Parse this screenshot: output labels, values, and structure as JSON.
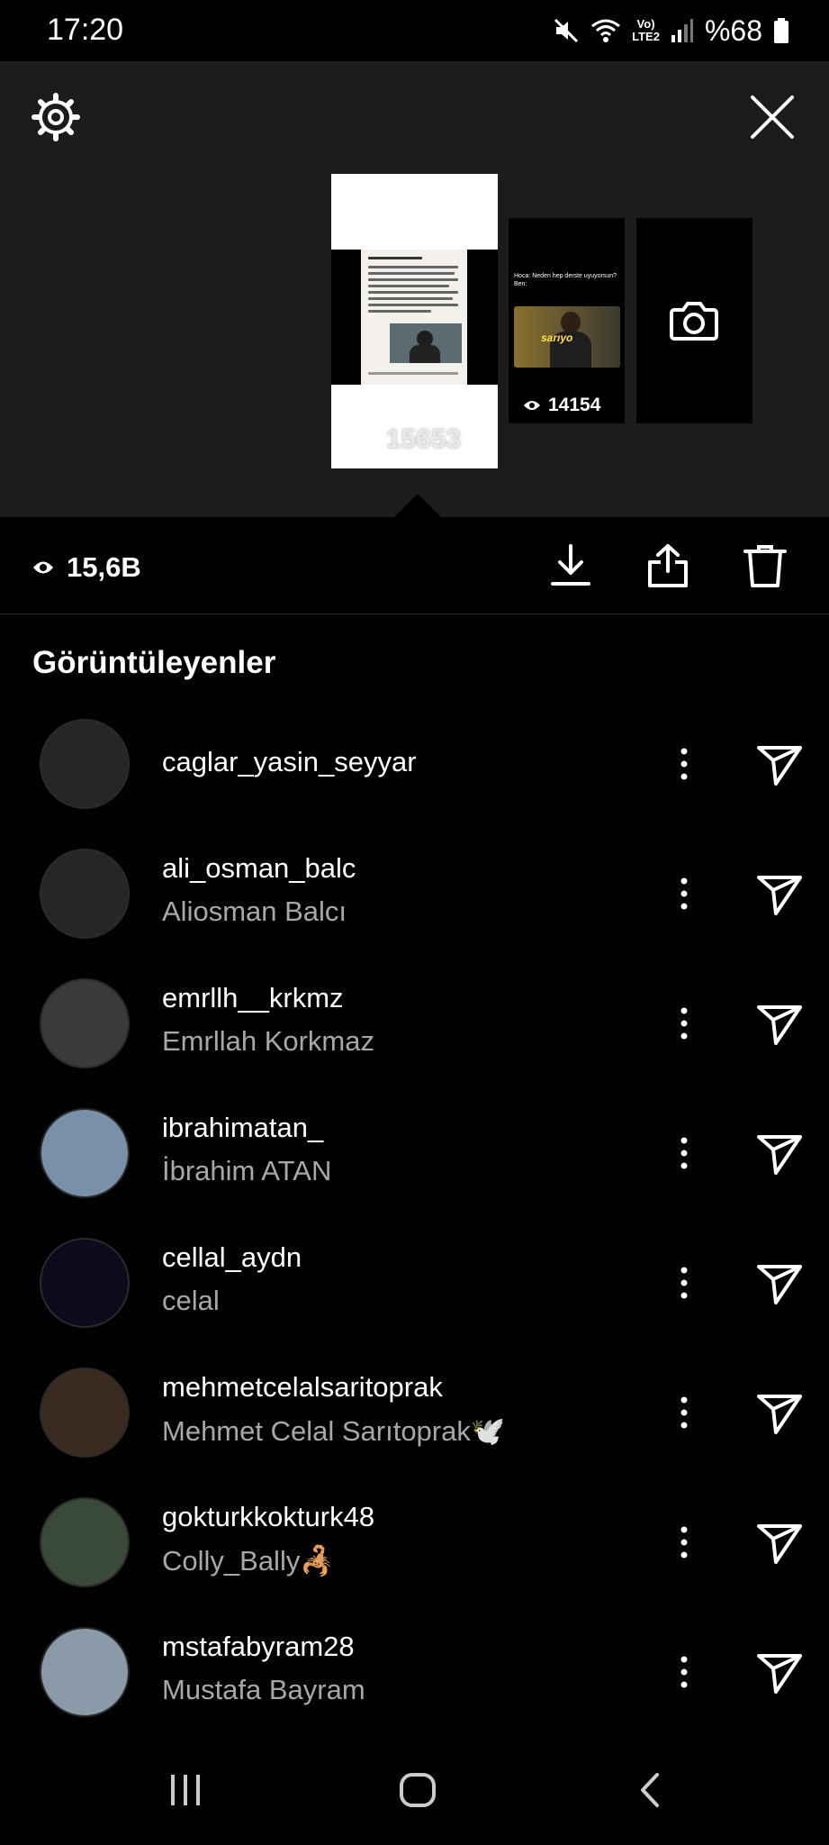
{
  "status_bar": {
    "time": "17:20",
    "network_top": "Vo)",
    "network_bottom": "LTE2",
    "battery": "%68",
    "icons": [
      "mute-icon",
      "wifi-icon",
      "signal-icon",
      "battery-icon"
    ]
  },
  "stories": [
    {
      "views": "15653",
      "selected": true
    },
    {
      "views": "14154",
      "caption": "Hoca: Neden hep derste uyuyorsun? Ben:",
      "sticker": "sarıyo"
    },
    {
      "type": "camera",
      "icon": "camera-icon"
    }
  ],
  "summary": {
    "total_views": "15,6B",
    "actions": [
      "download-icon",
      "share-icon",
      "trash-icon"
    ]
  },
  "viewers_title": "Görüntüleyenler",
  "viewers": [
    {
      "username": "caglar_yasin_seyyar",
      "fullname": "",
      "avatar_color": "#262626"
    },
    {
      "username": "ali_osman_balc",
      "fullname": "Aliosman Balcı",
      "avatar_color": "#262626"
    },
    {
      "username": "emrllh__krkmz",
      "fullname": "Emrllah Korkmaz",
      "avatar_color": "#3a3a3a"
    },
    {
      "username": "ibrahimatan_",
      "fullname": "İbrahim ATAN",
      "avatar_color": "#7a8fa8"
    },
    {
      "username": "cellal_aydn",
      "fullname": "celal",
      "avatar_color": "#0b0b1c"
    },
    {
      "username": "mehmetcelalsaritoprak",
      "fullname": "Mehmet Celal Sarıtoprak🕊️",
      "avatar_color": "#3b2a20"
    },
    {
      "username": "gokturkkokturk48",
      "fullname": "Colly_Bally🦂",
      "avatar_color": "#3a4a38"
    },
    {
      "username": "mstafabyram28",
      "fullname": "Mustafa Bayram",
      "avatar_color": "#8a9aa8"
    }
  ],
  "nav": [
    "recents-icon",
    "home-icon",
    "back-icon"
  ],
  "colors": {
    "background": "#000000",
    "header": "#1c1c1c",
    "secondary_text": "#a8a8a8"
  }
}
